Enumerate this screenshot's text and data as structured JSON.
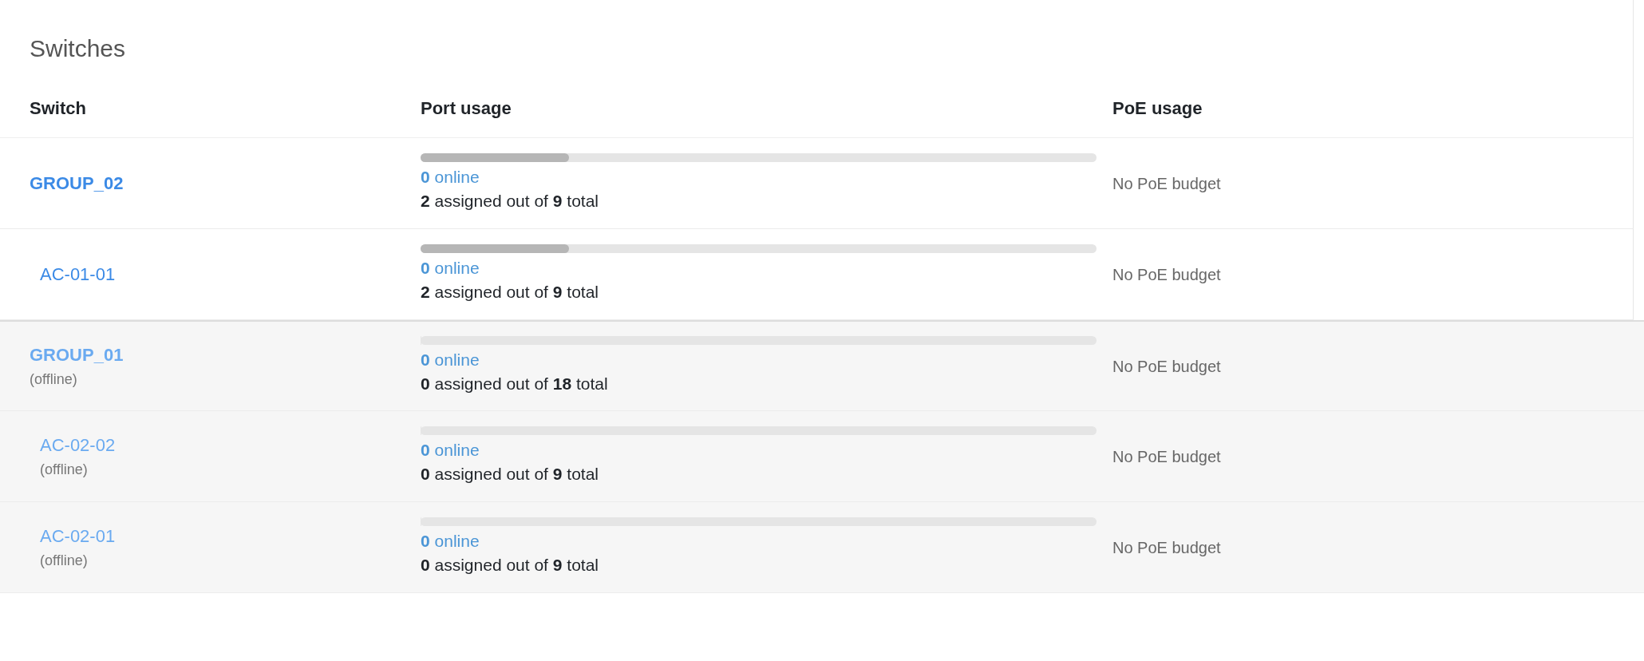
{
  "title": "Switches",
  "columns": [
    "Switch",
    "Port usage",
    "PoE usage"
  ],
  "rows": [
    {
      "kind": "group",
      "name": "GROUP_02",
      "offline": false,
      "level": 0.22,
      "online": "**0** online",
      "assigned": "**2** assigned out of **9** total",
      "poe": "No PoE budget"
    },
    {
      "kind": "switch",
      "name": "AC-01-01",
      "offline": false,
      "level": 0.22,
      "online": "**0** online",
      "assigned": "**2** assigned out of **9** total",
      "poe": "No PoE budget"
    },
    {
      "kind": "group",
      "name": "GROUP_01",
      "offline": true,
      "status": "(offline)",
      "level": 0,
      "online": "**0** online",
      "assigned": "**0** assigned out of **18** total",
      "poe": "No PoE budget"
    },
    {
      "kind": "switch",
      "name": "AC-02-02",
      "offline": true,
      "status": "(offline)",
      "level": 0,
      "online": "**0** online",
      "assigned": "**0** assigned out of **9** total",
      "poe": "No PoE budget"
    },
    {
      "kind": "switch",
      "name": "AC-02-01",
      "offline": true,
      "status": "(offline)",
      "level": 0,
      "online": "**0** online",
      "assigned": "**0** assigned out of **9** total",
      "poe": "No PoE budget"
    }
  ]
}
